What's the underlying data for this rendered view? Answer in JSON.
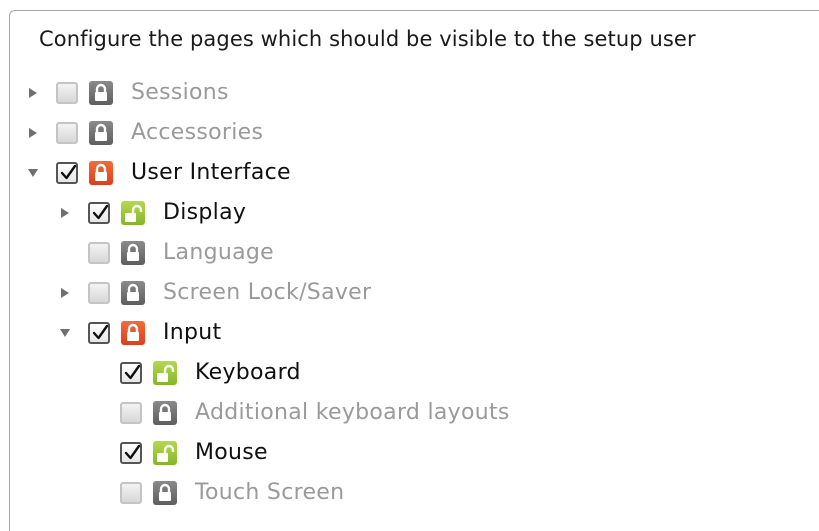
{
  "header": {
    "text": "Configure the pages which should be visible to the setup user"
  },
  "tree": [
    {
      "label": "Sessions",
      "depth": 0,
      "expander": "collapsed",
      "checked": false,
      "lock": "locked-gray",
      "active": false
    },
    {
      "label": "Accessories",
      "depth": 0,
      "expander": "collapsed",
      "checked": false,
      "lock": "locked-gray",
      "active": false
    },
    {
      "label": "User Interface",
      "depth": 0,
      "expander": "expanded",
      "checked": true,
      "lock": "locked-red",
      "active": true
    },
    {
      "label": "Display",
      "depth": 1,
      "expander": "collapsed",
      "checked": true,
      "lock": "unlocked-green",
      "active": true
    },
    {
      "label": "Language",
      "depth": 1,
      "expander": "none",
      "checked": false,
      "lock": "locked-gray",
      "active": false
    },
    {
      "label": "Screen Lock/Saver",
      "depth": 1,
      "expander": "collapsed",
      "checked": false,
      "lock": "locked-gray",
      "active": false
    },
    {
      "label": "Input",
      "depth": 1,
      "expander": "expanded",
      "checked": true,
      "lock": "locked-red",
      "active": true
    },
    {
      "label": "Keyboard",
      "depth": 2,
      "expander": "none",
      "checked": true,
      "lock": "unlocked-green",
      "active": true
    },
    {
      "label": "Additional keyboard layouts",
      "depth": 2,
      "expander": "none",
      "checked": false,
      "lock": "locked-gray",
      "active": false
    },
    {
      "label": "Mouse",
      "depth": 2,
      "expander": "none",
      "checked": true,
      "lock": "unlocked-green",
      "active": true
    },
    {
      "label": "Touch Screen",
      "depth": 2,
      "expander": "none",
      "checked": false,
      "lock": "locked-gray",
      "active": false
    }
  ]
}
